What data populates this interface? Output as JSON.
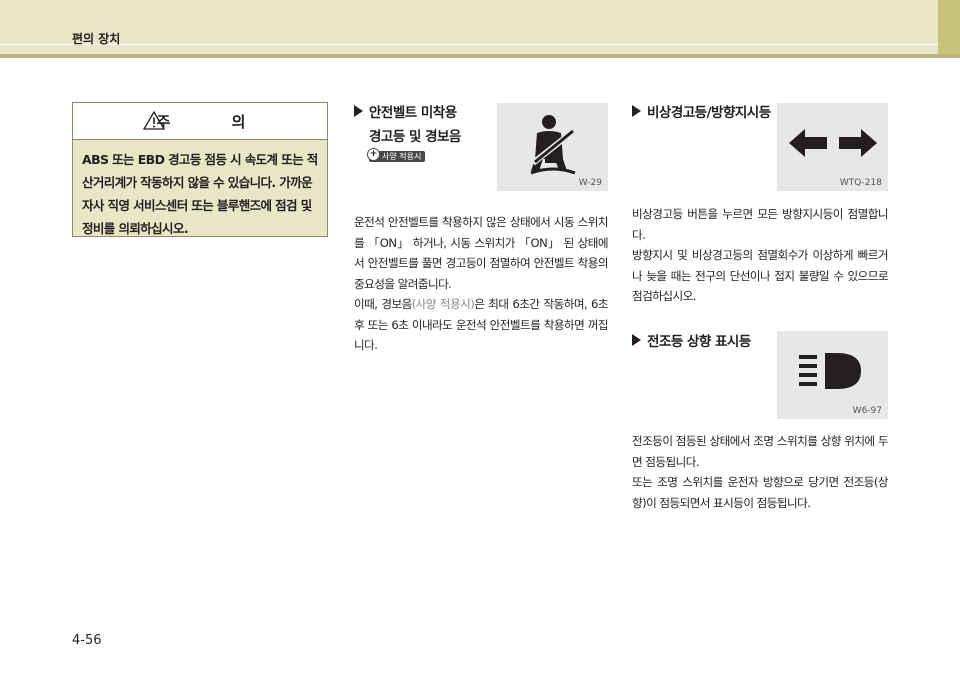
{
  "header": {
    "section_title": "편의 장치"
  },
  "caution": {
    "title": "주 의",
    "body": "ABS 또는 EBD 경고등 점등 시 속도계 또는 적산거리계가 작동하지 않을 수 있습니다. 가까운 자사 직영 서비스센터 또는 블루핸즈에 점검 및 정비를 의뢰하십시오."
  },
  "seatbelt": {
    "heading_line1": "안전벨트 미착용",
    "heading_line2": "경고등 및 경보음",
    "badge": "사양 적용시",
    "image_code": "W-29",
    "body_part1": "운전석 안전벨트를 착용하지 않은 상태에서 시동 스위치를 「ON」 하거나, 시동 스위치가 「ON」 된 상태에서 안전벨트를 풀면 경고등이 점멸하여 안전벨트 착용의 중요성을 알려줍니다.",
    "body_part2a": "이때, 경보음",
    "body_part2b": "(사양 적용시)",
    "body_part2c": "은 최대 6초간 작동하며, 6초 후 또는 6초 이내라도 운전석 안전벨트를 착용하면 꺼집니다."
  },
  "hazard": {
    "heading": "비상경고등/방향지시등",
    "image_code": "WTQ-218",
    "body_part1": "비상경고등 버튼을 누르면 모든 방향지시등이 점멸합니다.",
    "body_part2": "방향지시 및 비상경고등의 점멸회수가 이상하게 빠르거나 늦을 때는 전구의 단선이나 접지 불량일 수 있으므로 점검하십시오."
  },
  "highbeam": {
    "heading": "전조등 상향 표시등",
    "image_code": "W6-97",
    "body_part1": "전조등이 점등된 상태에서 조명 스위치를 상향 위치에 두면 점등됩니다.",
    "body_part2": "또는 조명 스위치를 운전자 방향으로 당기면 전조등(상향)이 점등되면서 표시등이 점등됩니다."
  },
  "footer": {
    "page_number": "4-56"
  },
  "colors": {
    "header_bg": "#e9e6c7",
    "header_strip": "#b9b386",
    "caution_bg": "#e9e6c7",
    "image_bg": "#e6e7e8"
  }
}
